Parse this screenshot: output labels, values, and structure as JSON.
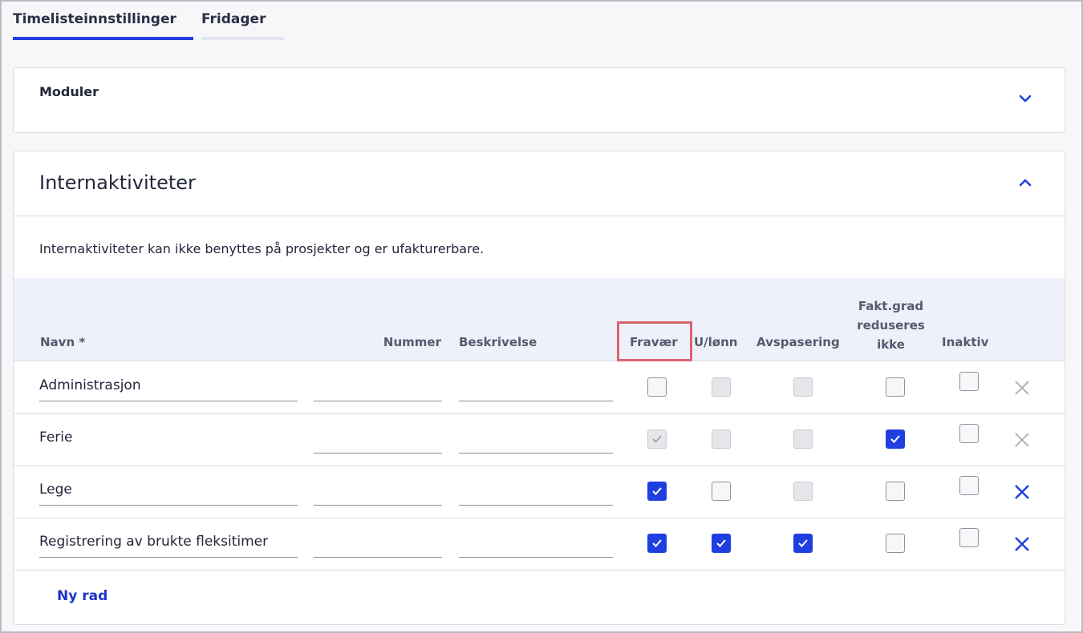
{
  "tabs": [
    {
      "label": "Timelisteinnstillinger",
      "active": true
    },
    {
      "label": "Fridager",
      "active": false
    }
  ],
  "modules": {
    "title": "Moduler",
    "icon": "chevron-down-icon"
  },
  "internal": {
    "title": "Internaktiviteter",
    "icon": "chevron-up-icon",
    "description": "Internaktiviteter kan ikke benyttes på prosjekter og er ufakturerbare.",
    "headers": {
      "name": "Navn *",
      "number": "Nummer",
      "description": "Beskrivelse",
      "absence": "Fravær",
      "unpaid": "U/lønn",
      "compensation": "Avspasering",
      "fakt_line1": "Fakt.grad",
      "fakt_line2": "reduseres",
      "fakt_line3": "ikke",
      "inactive": "Inaktiv"
    },
    "rows": [
      {
        "name": "Administrasjon",
        "number": "",
        "description": ""
      },
      {
        "name": "Ferie",
        "number": "",
        "description": ""
      },
      {
        "name": "Lege",
        "number": "",
        "description": ""
      },
      {
        "name": "Registrering av brukte fleksitimer",
        "number": "",
        "description": ""
      }
    ],
    "new_row_label": "Ny rad"
  },
  "colors": {
    "accent": "#1f3fe0",
    "highlight_border": "#d9646c",
    "header_bg": "#eef0fa"
  }
}
